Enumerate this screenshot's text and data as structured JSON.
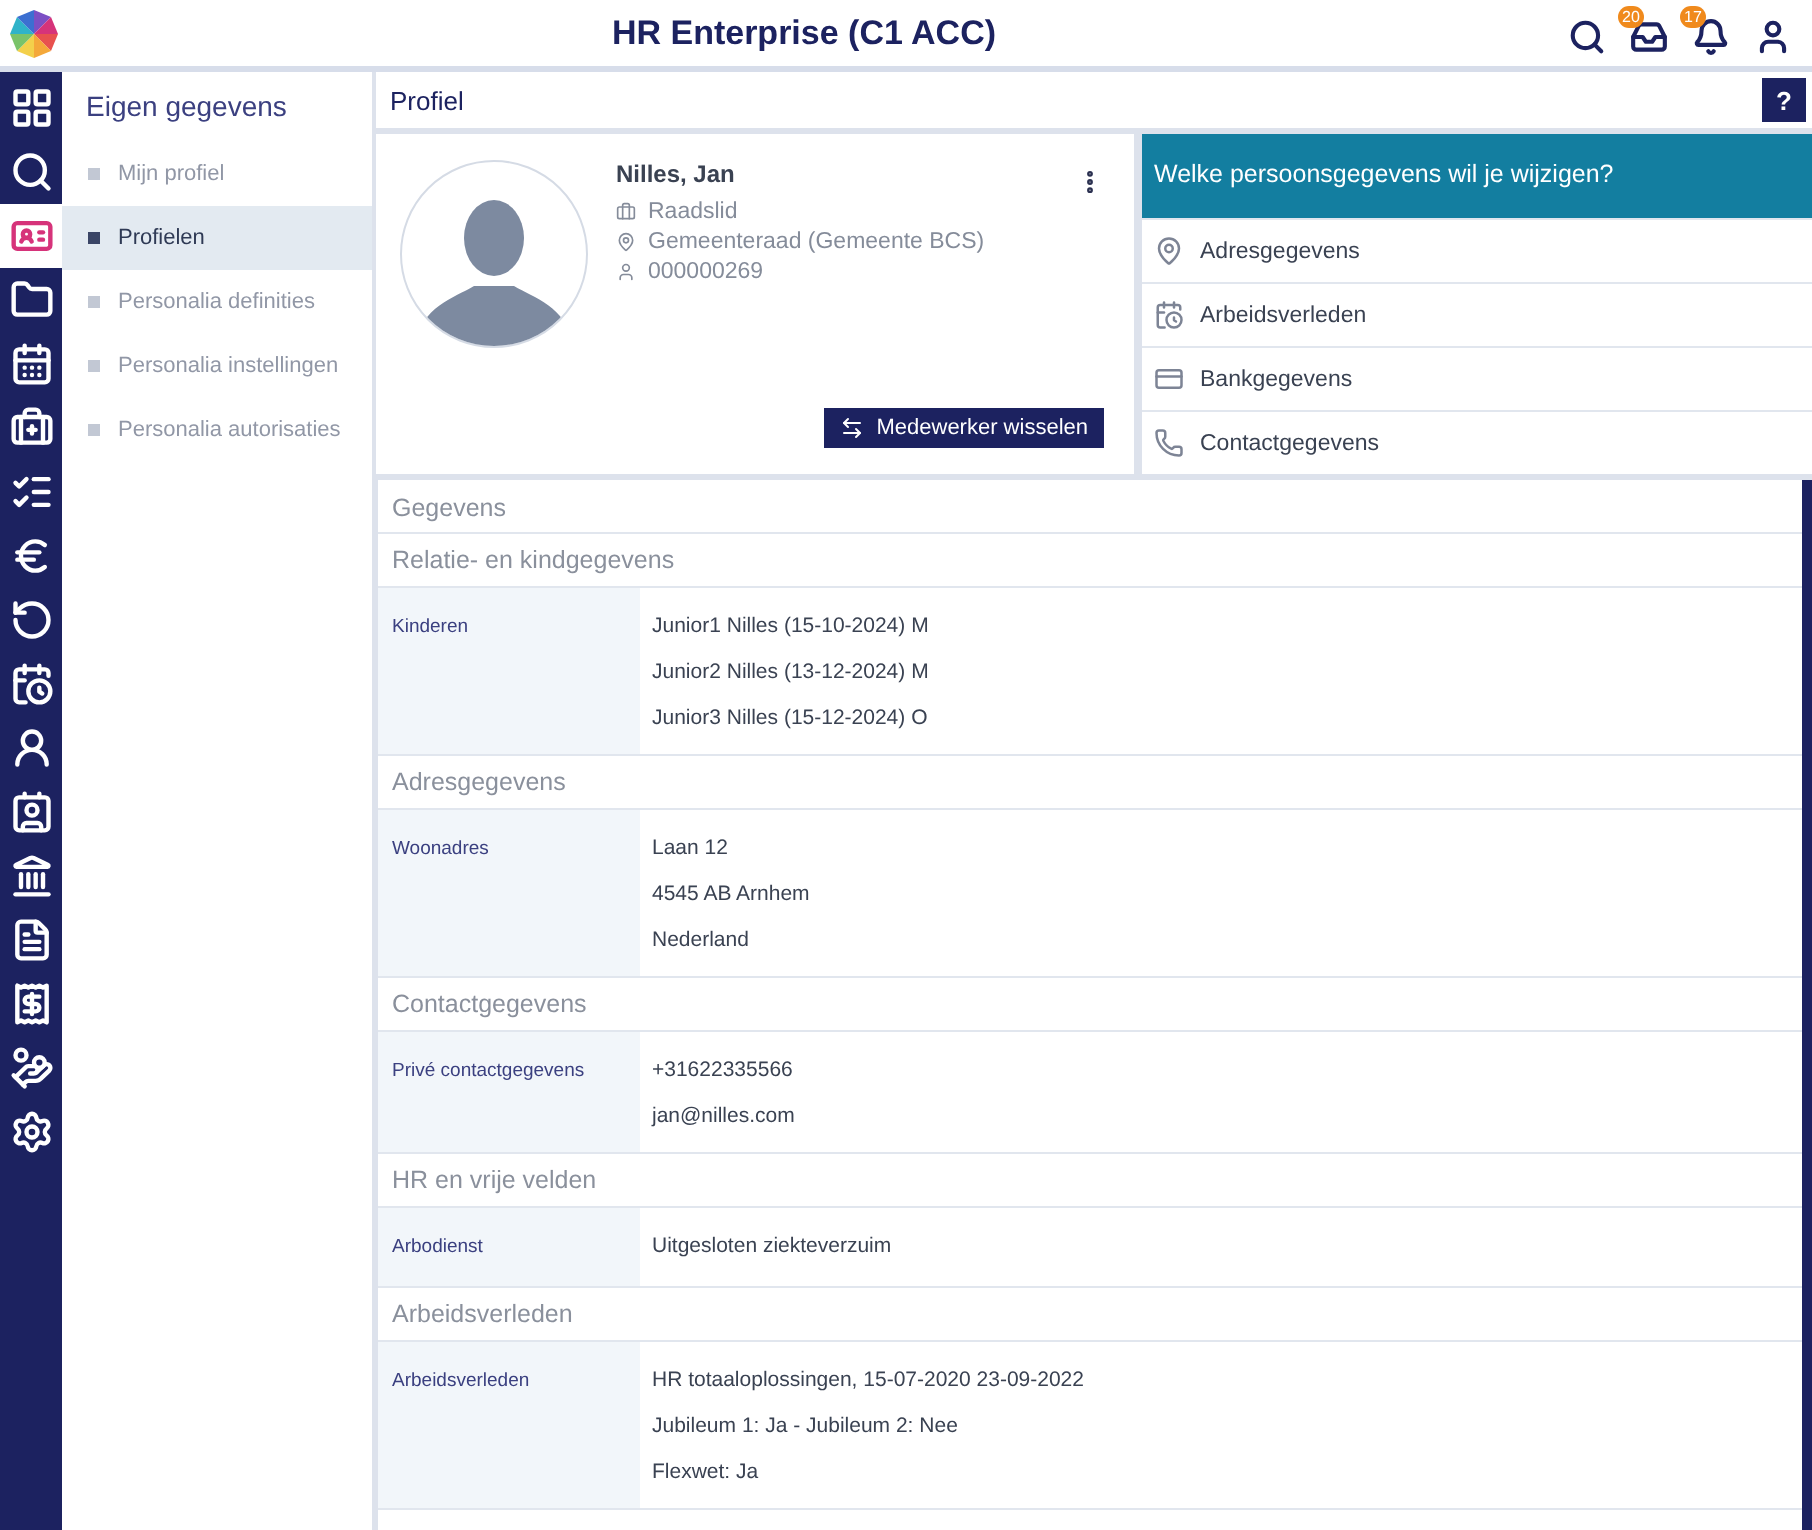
{
  "header": {
    "title": "HR Enterprise (C1 ACC)",
    "inbox_badge": "20",
    "bell_badge": "17"
  },
  "rail": [
    {
      "selected": false
    },
    {
      "selected": false
    },
    {
      "selected": true
    },
    {
      "selected": false
    },
    {
      "selected": false
    },
    {
      "selected": false
    },
    {
      "selected": false
    },
    {
      "selected": false
    },
    {
      "selected": false
    },
    {
      "selected": false
    },
    {
      "selected": false
    },
    {
      "selected": false
    },
    {
      "selected": false
    },
    {
      "selected": false
    },
    {
      "selected": false
    },
    {
      "selected": false
    },
    {
      "selected": false
    }
  ],
  "submenu": {
    "title": "Eigen gegevens",
    "items": [
      {
        "label": "Mijn profiel",
        "selected": false
      },
      {
        "label": "Profielen",
        "selected": true
      },
      {
        "label": "Personalia definities",
        "selected": false
      },
      {
        "label": "Personalia instellingen",
        "selected": false
      },
      {
        "label": "Personalia autorisaties",
        "selected": false
      }
    ]
  },
  "page": {
    "title": "Profiel",
    "help": "?"
  },
  "profile": {
    "name": "Nilles, Jan",
    "function": "Raadslid",
    "department": "Gemeenteraad (Gemeente BCS)",
    "number": "000000269",
    "button": "Medewerker wisselen"
  },
  "change_panel": {
    "title": "Welke persoonsgegevens wil je wijzigen?",
    "items": [
      "Adresgegevens",
      "Arbeidsverleden",
      "Bankgegevens",
      "Contactgegevens"
    ]
  },
  "details": {
    "title": "Gegevens",
    "sections": [
      {
        "title": "Relatie- en kindgegevens",
        "rows": [
          {
            "label": "Kinderen",
            "values": [
              "Junior1 Nilles (15-10-2024) M",
              "Junior2 Nilles (13-12-2024) M",
              "Junior3 Nilles (15-12-2024) O"
            ]
          }
        ]
      },
      {
        "title": "Adresgegevens",
        "rows": [
          {
            "label": "Woonadres",
            "values": [
              "Laan 12",
              "4545 AB Arnhem",
              "Nederland"
            ]
          }
        ]
      },
      {
        "title": "Contactgegevens",
        "rows": [
          {
            "label": "Privé contactgegevens",
            "values": [
              "+31622335566",
              "jan@nilles.com"
            ]
          }
        ]
      },
      {
        "title": "HR en vrije velden",
        "rows": [
          {
            "label": "Arbodienst",
            "values": [
              "Uitgesloten ziekteverzuim"
            ]
          }
        ]
      },
      {
        "title": "Arbeidsverleden",
        "rows": [
          {
            "label": "Arbeidsverleden",
            "values": [
              "HR totaaloplossingen, 15-07-2020 23-09-2022",
              "Jubileum 1: Ja - Jubileum 2: Nee",
              "Flexwet: Ja"
            ]
          }
        ]
      }
    ]
  }
}
